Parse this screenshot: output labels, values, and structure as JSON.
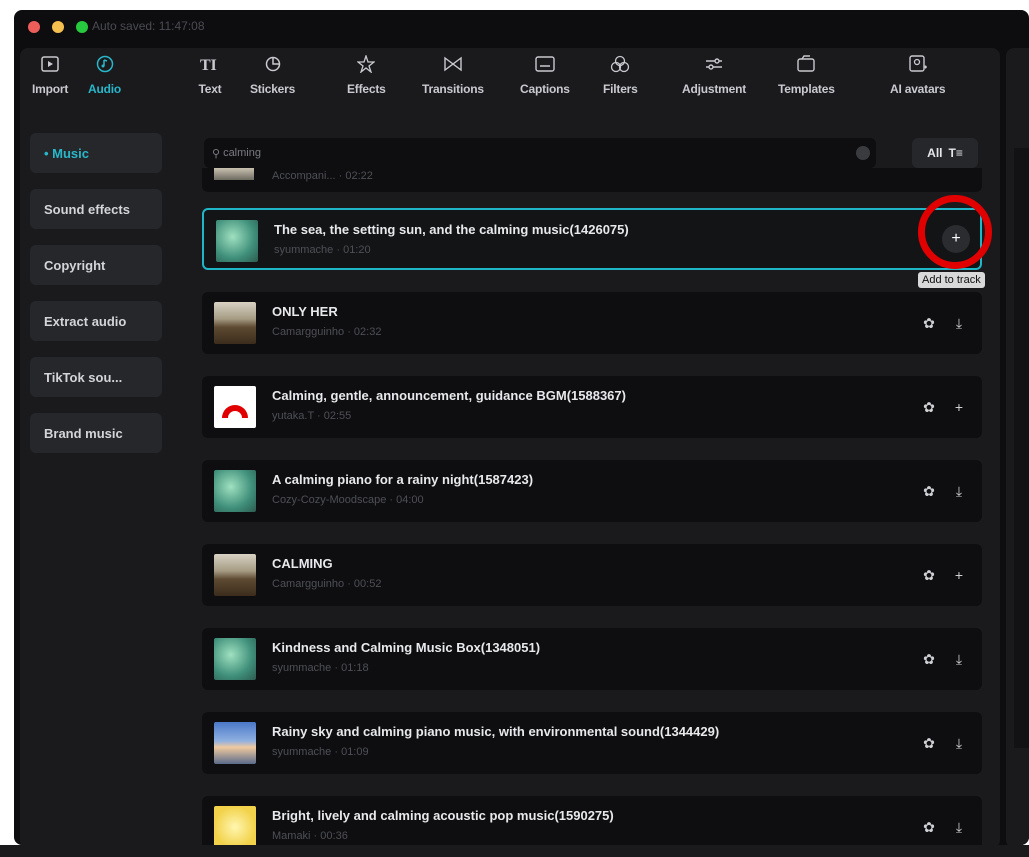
{
  "window": {
    "autosave_text": "Auto saved: 11:47:08"
  },
  "toolbar": [
    {
      "label": "Import",
      "icon": "import-icon"
    },
    {
      "label": "Audio",
      "icon": "audio-icon",
      "active": true
    },
    {
      "label": "Text",
      "icon": "text-icon"
    },
    {
      "label": "Stickers",
      "icon": "stickers-icon"
    },
    {
      "label": "Effects",
      "icon": "effects-icon"
    },
    {
      "label": "Transitions",
      "icon": "transitions-icon"
    },
    {
      "label": "Captions",
      "icon": "captions-icon"
    },
    {
      "label": "Filters",
      "icon": "filters-icon"
    },
    {
      "label": "Adjustment",
      "icon": "adjustment-icon"
    },
    {
      "label": "Templates",
      "icon": "templates-icon"
    },
    {
      "label": "AI avatars",
      "icon": "ai-avatars-icon"
    }
  ],
  "sidebar": {
    "items": [
      {
        "label": "• Music",
        "active": true
      },
      {
        "label": "Sound effects"
      },
      {
        "label": "Copyright"
      },
      {
        "label": "Extract audio"
      },
      {
        "label": "TikTok sou..."
      },
      {
        "label": "Brand music"
      }
    ]
  },
  "search": {
    "value": "calming",
    "filter_label": "All"
  },
  "tooltip": "Add to track",
  "tracks": [
    {
      "title": "The sea, the setting sun, and the calming music(1426075)",
      "subtitle": "syummache · 01:20",
      "selected": true
    },
    {
      "title": "ONLY HER",
      "subtitle": "Camargguinho · 02:32"
    },
    {
      "title": "Calming, gentle, announcement, guidance BGM(1588367)",
      "subtitle": "yutaka.T · 02:55"
    },
    {
      "title": "A calming piano for a rainy night(1587423)",
      "subtitle": "Cozy-Cozy-Moodscape · 04:00"
    },
    {
      "title": "CALMING",
      "subtitle": "Camargguinho · 00:52"
    },
    {
      "title": "Kindness and Calming Music Box(1348051)",
      "subtitle": "syummache · 01:18"
    },
    {
      "title": "Rainy sky and calming piano music, with environmental sound(1344429)",
      "subtitle": "syummache · 01:09"
    },
    {
      "title": "Bright, lively and calming acoustic pop music(1590275)",
      "subtitle": "Mamaki · 00:36"
    }
  ],
  "partial_track_subtitle": "Accompani... · 02:22",
  "colors": {
    "accent": "#1fb6c8",
    "highlight_ring": "#e00000"
  }
}
